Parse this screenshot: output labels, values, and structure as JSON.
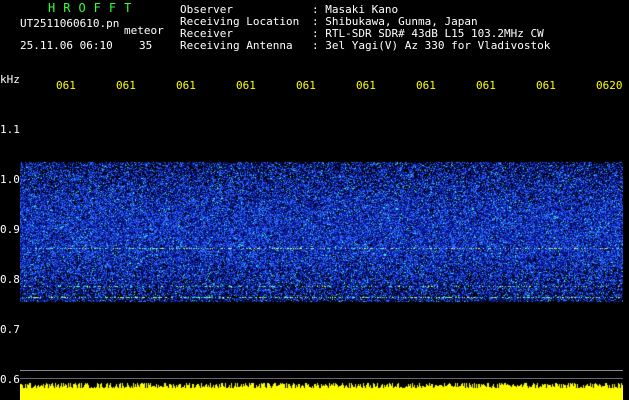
{
  "header": {
    "title": "HROFFT",
    "filename": "UT2511060610.pn",
    "meteor_label": "meteor",
    "datetime": "25.11.06 06:10",
    "count": "35"
  },
  "station": {
    "rows": [
      {
        "key": "Observer",
        "value": ": Masaki Kano"
      },
      {
        "key": "Receiving Location",
        "value": ": Shibukawa, Gunma, Japan"
      },
      {
        "key": "Receiver",
        "value": ": RTL-SDR SDR# 43dB L15 103.2MHz CW"
      },
      {
        "key": "Receiving Antenna",
        "value": ": 3el Yagi(V) Az 330 for Vladivostok"
      }
    ]
  },
  "axis": {
    "unit": "kHz",
    "time_ticks": [
      "061",
      "061",
      "061",
      "061",
      "061",
      "061",
      "061",
      "061",
      "061",
      "0620"
    ],
    "freq_labels": [
      "1.1",
      "1.0",
      "0.9",
      "0.8",
      "0.7",
      "0.6"
    ]
  },
  "colors": {
    "background": "#000000",
    "title": "#33ff33",
    "ticks": "#ffff00",
    "text": "#ffffff",
    "noise_low": "#0a1a9e",
    "noise_mid": "#2a6cff",
    "noise_hi": "#33ffcc",
    "baseline": "#ffff00"
  }
}
